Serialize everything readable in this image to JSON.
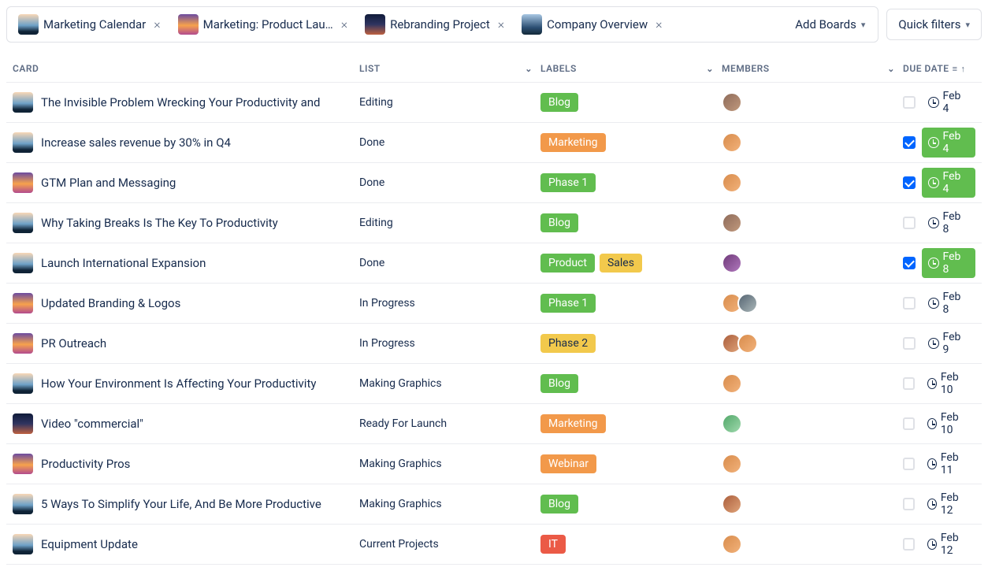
{
  "topbar": {
    "tabs": [
      {
        "label": "Marketing Calendar",
        "thumb": "thumb-beach"
      },
      {
        "label": "Marketing: Product Lau…",
        "thumb": "thumb-sunset"
      },
      {
        "label": "Rebranding Project",
        "thumb": "thumb-rocket"
      },
      {
        "label": "Company Overview",
        "thumb": "thumb-sky"
      }
    ],
    "add_boards_label": "Add Boards",
    "quick_filters_label": "Quick filters"
  },
  "columns": {
    "card": "CARD",
    "list": "LIST",
    "labels": "LABELS",
    "members": "MEMBERS",
    "due_date": "DUE DATE"
  },
  "rows": [
    {
      "thumb": "thumb-beach",
      "title": "The Invisible Problem Wrecking Your Productivity and",
      "list": "Editing",
      "labels": [
        {
          "text": "Blog",
          "cls": "lbl-green"
        }
      ],
      "members": [
        "av-a"
      ],
      "checked": false,
      "done": false,
      "due": "Feb 4"
    },
    {
      "thumb": "thumb-beach",
      "title": "Increase sales revenue by 30% in Q4",
      "list": "Done",
      "labels": [
        {
          "text": "Marketing",
          "cls": "lbl-orange"
        }
      ],
      "members": [
        "av-b"
      ],
      "checked": true,
      "done": true,
      "due": "Feb 4"
    },
    {
      "thumb": "thumb-sunset",
      "title": "GTM Plan and Messaging",
      "list": "Done",
      "labels": [
        {
          "text": "Phase 1",
          "cls": "lbl-green"
        }
      ],
      "members": [
        "av-b"
      ],
      "checked": true,
      "done": true,
      "due": "Feb 4"
    },
    {
      "thumb": "thumb-beach",
      "title": "Why Taking Breaks Is The Key To Productivity",
      "list": "Editing",
      "labels": [
        {
          "text": "Blog",
          "cls": "lbl-green"
        }
      ],
      "members": [
        "av-a"
      ],
      "checked": false,
      "done": false,
      "due": "Feb 8"
    },
    {
      "thumb": "thumb-beach",
      "title": "Launch International Expansion",
      "list": "Done",
      "labels": [
        {
          "text": "Product",
          "cls": "lbl-green"
        },
        {
          "text": "Sales",
          "cls": "lbl-yellow"
        }
      ],
      "members": [
        "av-c"
      ],
      "checked": true,
      "done": true,
      "due": "Feb 8"
    },
    {
      "thumb": "thumb-sunset",
      "title": "Updated Branding & Logos",
      "list": "In Progress",
      "labels": [
        {
          "text": "Phase 1",
          "cls": "lbl-green"
        }
      ],
      "members": [
        "av-b",
        "av-d"
      ],
      "checked": false,
      "done": false,
      "due": "Feb 8"
    },
    {
      "thumb": "thumb-sunset",
      "title": "PR Outreach",
      "list": "In Progress",
      "labels": [
        {
          "text": "Phase 2",
          "cls": "lbl-yellow"
        }
      ],
      "members": [
        "av-f",
        "av-b"
      ],
      "checked": false,
      "done": false,
      "due": "Feb 9"
    },
    {
      "thumb": "thumb-beach",
      "title": "How Your Environment Is Affecting Your Productivity",
      "list": "Making Graphics",
      "labels": [
        {
          "text": "Blog",
          "cls": "lbl-green"
        }
      ],
      "members": [
        "av-b"
      ],
      "checked": false,
      "done": false,
      "due": "Feb 10"
    },
    {
      "thumb": "thumb-rocket",
      "title": "Video \"commercial\"",
      "list": "Ready For Launch",
      "labels": [
        {
          "text": "Marketing",
          "cls": "lbl-orange"
        }
      ],
      "members": [
        "av-e"
      ],
      "checked": false,
      "done": false,
      "due": "Feb 10"
    },
    {
      "thumb": "thumb-sunset",
      "title": "Productivity Pros",
      "list": "Making Graphics",
      "labels": [
        {
          "text": "Webinar",
          "cls": "lbl-orange"
        }
      ],
      "members": [
        "av-b"
      ],
      "checked": false,
      "done": false,
      "due": "Feb 11"
    },
    {
      "thumb": "thumb-beach",
      "title": "5 Ways To Simplify Your Life, And Be More Productive",
      "list": "Making Graphics",
      "labels": [
        {
          "text": "Blog",
          "cls": "lbl-green"
        }
      ],
      "members": [
        "av-f"
      ],
      "checked": false,
      "done": false,
      "due": "Feb 12"
    },
    {
      "thumb": "thumb-beach",
      "title": "Equipment Update",
      "list": "Current Projects",
      "labels": [
        {
          "text": "IT",
          "cls": "lbl-red"
        }
      ],
      "members": [
        "av-b"
      ],
      "checked": false,
      "done": false,
      "due": "Feb 12"
    }
  ]
}
